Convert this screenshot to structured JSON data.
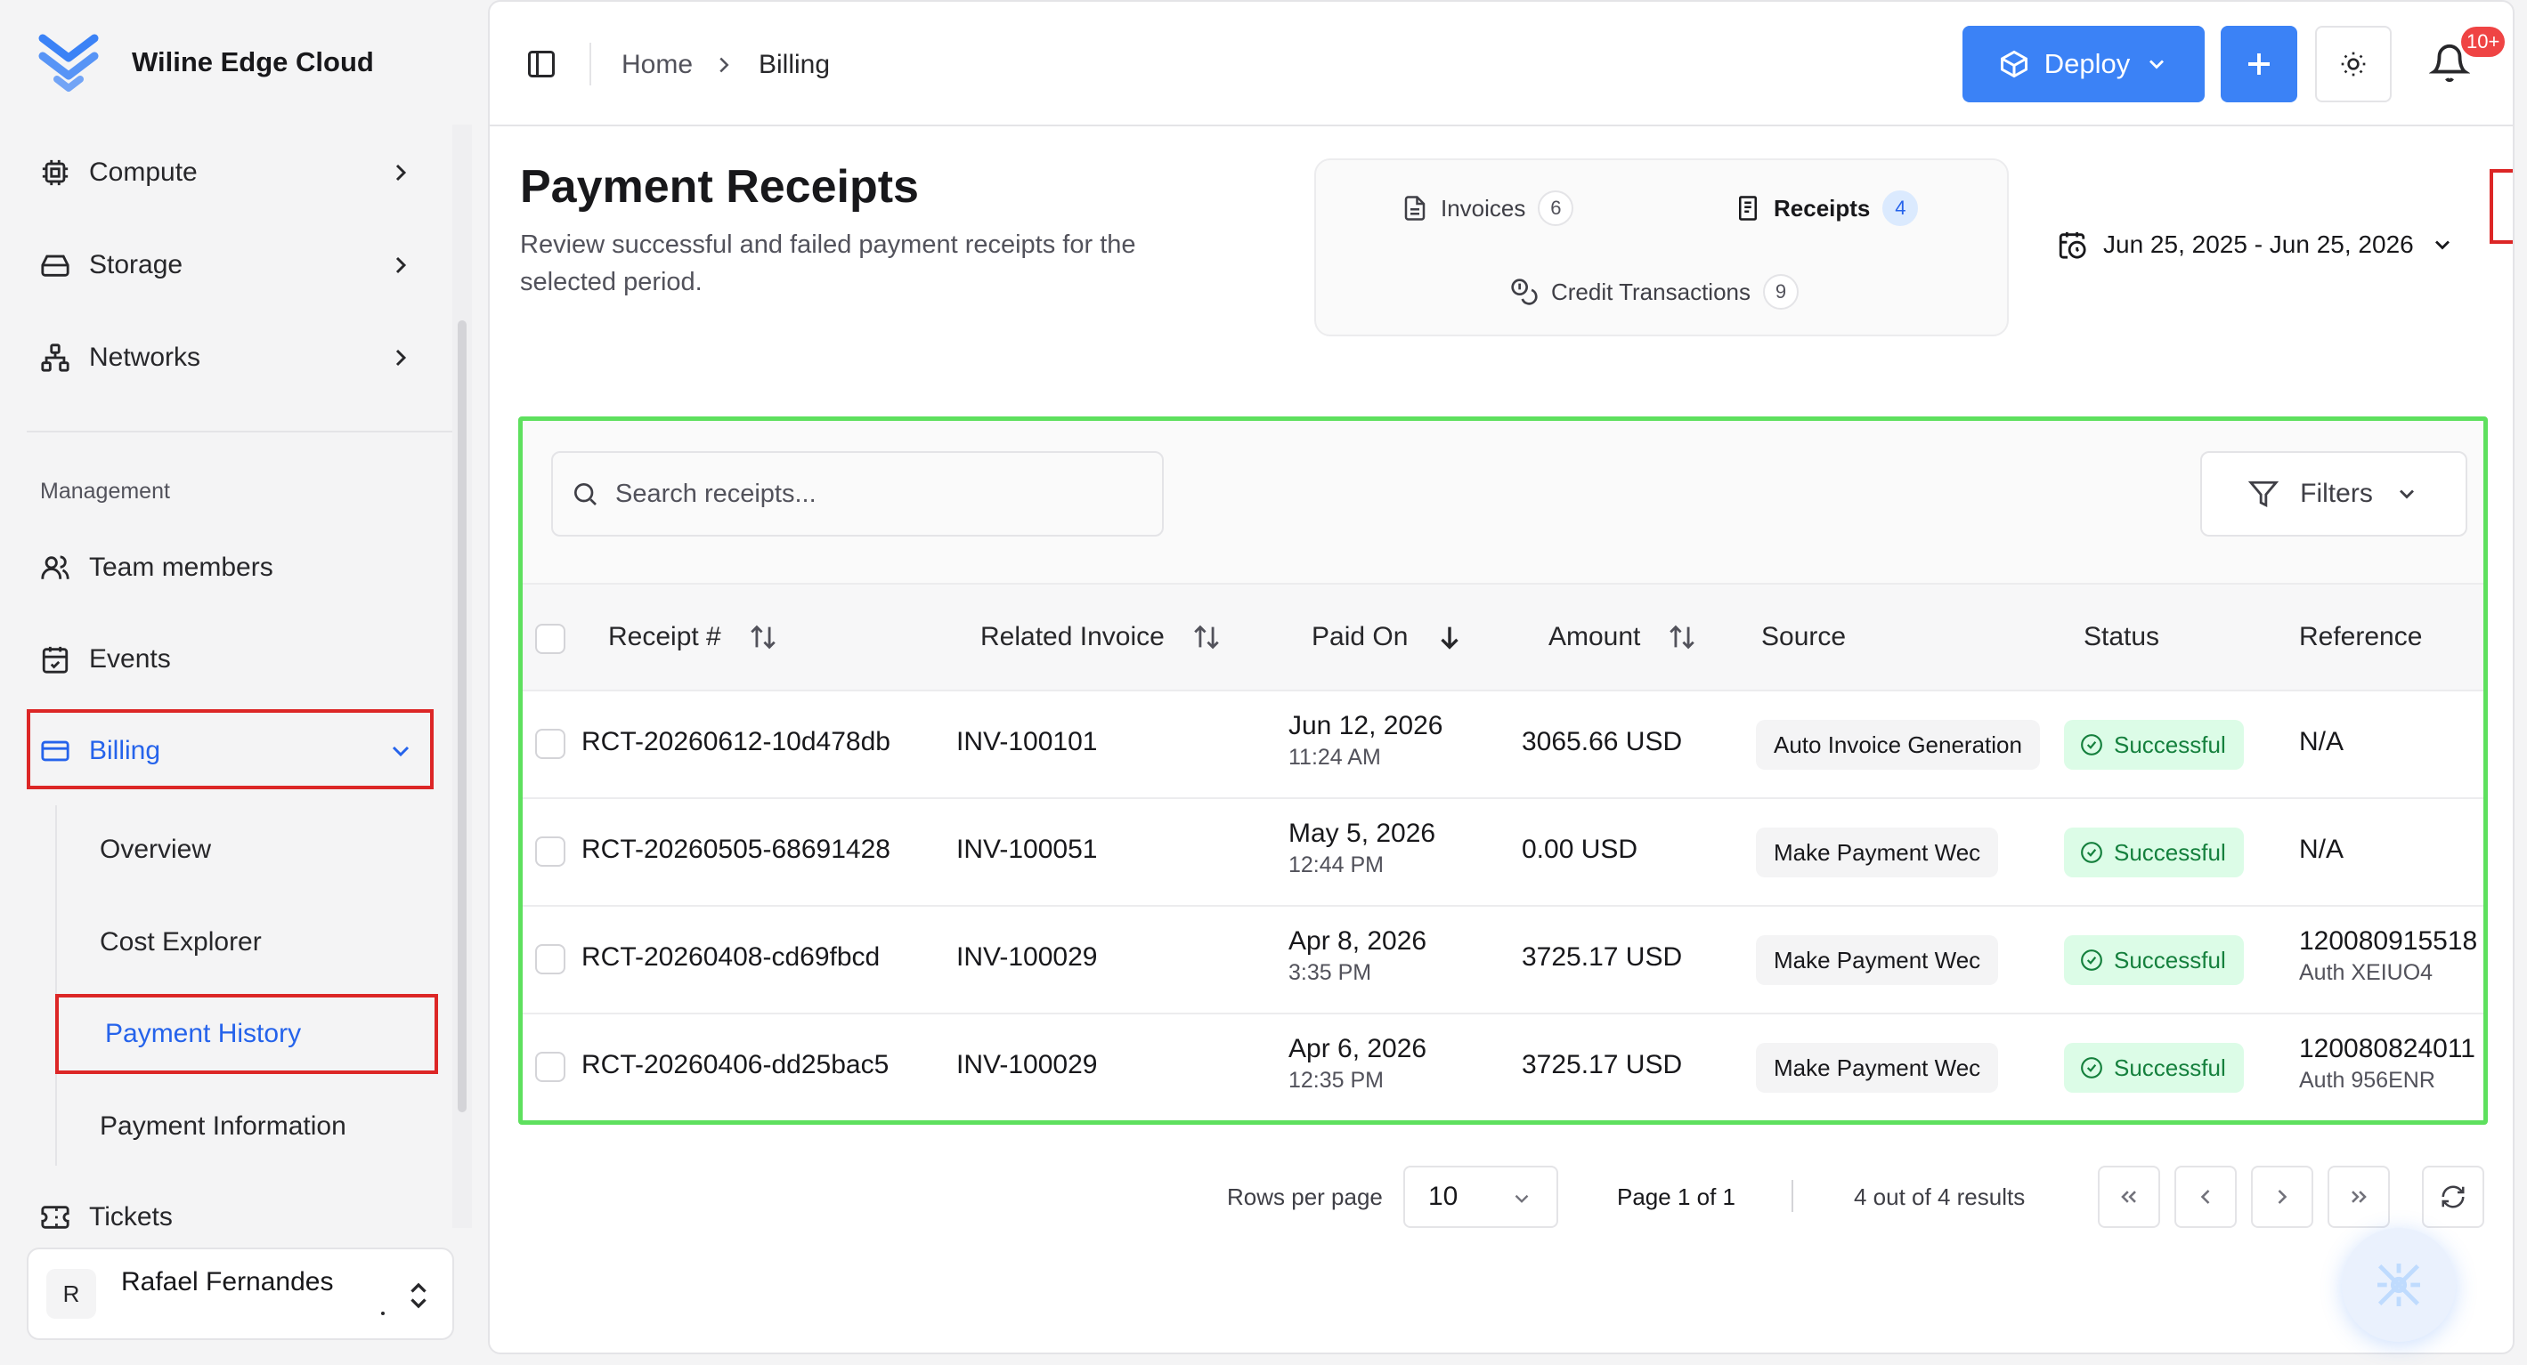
{
  "brand": {
    "name": "Wiline Edge Cloud",
    "logo_color": "#3b82f6"
  },
  "sidebar": {
    "items": [
      {
        "label": "Compute",
        "icon": "cpu-icon"
      },
      {
        "label": "Storage",
        "icon": "hard-drive-icon"
      },
      {
        "label": "Networks",
        "icon": "network-icon"
      }
    ],
    "section_label": "Management",
    "management": [
      {
        "label": "Team members",
        "icon": "users-icon"
      },
      {
        "label": "Events",
        "icon": "calendar-icon"
      },
      {
        "label": "Billing",
        "icon": "credit-card-icon"
      }
    ],
    "billing_sub": [
      "Overview",
      "Cost Explorer",
      "Payment History",
      "Payment Information"
    ],
    "tickets": {
      "label": "Tickets",
      "icon": "ticket-icon"
    },
    "user": {
      "initial": "R",
      "name": "Rafael Fernandes"
    }
  },
  "header": {
    "breadcrumb": [
      "Home",
      "Billing"
    ],
    "deploy_label": "Deploy",
    "notification_badge": "10+"
  },
  "page": {
    "title": "Payment Receipts",
    "subtitle": "Review successful and failed payment receipts for the selected period.",
    "tabs": [
      {
        "label": "Invoices",
        "count": "6"
      },
      {
        "label": "Receipts",
        "count": "4"
      },
      {
        "label": "Credit Transactions",
        "count": "9"
      }
    ],
    "date_range": "Jun 25, 2025 - Jun 25, 2026"
  },
  "table": {
    "search_placeholder": "Search receipts...",
    "filters_label": "Filters",
    "columns": [
      "Receipt #",
      "Related Invoice",
      "Paid On",
      "Amount",
      "Source",
      "Status",
      "Reference"
    ],
    "rows": [
      {
        "receipt": "RCT-20260612-10d478db",
        "invoice": "INV-100101",
        "date": "Jun 12, 2026",
        "time": "11:24 AM",
        "amount": "3065.66 USD",
        "source": "Auto Invoice Generation",
        "status": "Successful",
        "reference": "N/A",
        "reference_sub": ""
      },
      {
        "receipt": "RCT-20260505-68691428",
        "invoice": "INV-100051",
        "date": "May 5, 2026",
        "time": "12:44 PM",
        "amount": "0.00 USD",
        "source": "Make Payment Wec",
        "status": "Successful",
        "reference": "N/A",
        "reference_sub": ""
      },
      {
        "receipt": "RCT-20260408-cd69fbcd",
        "invoice": "INV-100029",
        "date": "Apr 8, 2026",
        "time": "3:35 PM",
        "amount": "3725.17 USD",
        "source": "Make Payment Wec",
        "status": "Successful",
        "reference": "120080915518",
        "reference_sub": "Auth XEIUO4"
      },
      {
        "receipt": "RCT-20260406-dd25bac5",
        "invoice": "INV-100029",
        "date": "Apr 6, 2026",
        "time": "12:35 PM",
        "amount": "3725.17 USD",
        "source": "Make Payment Wec",
        "status": "Successful",
        "reference": "120080824011",
        "reference_sub": "Auth 956ENR"
      }
    ]
  },
  "pagination": {
    "rows_label": "Rows per page",
    "rows_value": "10",
    "page_info": "Page 1 of 1",
    "results": "4 out of 4 results"
  },
  "colors": {
    "accent": "#3b82f6",
    "success": "#15803d",
    "highlight_red": "#dc2626",
    "highlight_green": "#5ee05e"
  }
}
